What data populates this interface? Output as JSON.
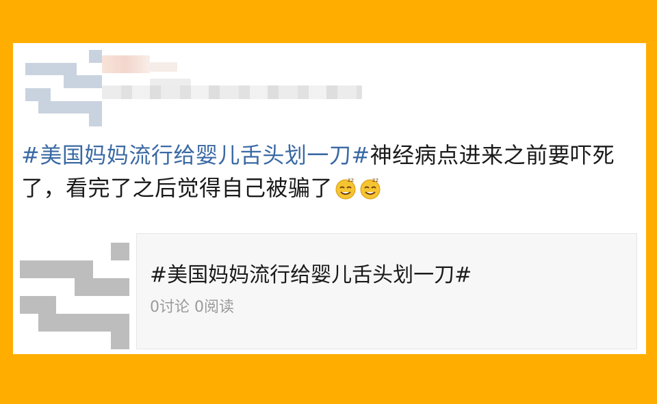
{
  "post": {
    "hashtag": "#美国妈妈流行给婴儿舌头划一刀#",
    "body_text": "神经病点进来之前要吓死了，看完了之后觉得自己被骗了",
    "emojis": [
      "doge-icon",
      "doge-icon"
    ]
  },
  "topic_card": {
    "title": "#美国妈妈流行给婴儿舌头划一刀#",
    "meta": "0讨论 0阅读"
  },
  "colors": {
    "background": "#FFAE00",
    "hashtag": "#3a69a3",
    "meta": "#9a9a9a"
  }
}
